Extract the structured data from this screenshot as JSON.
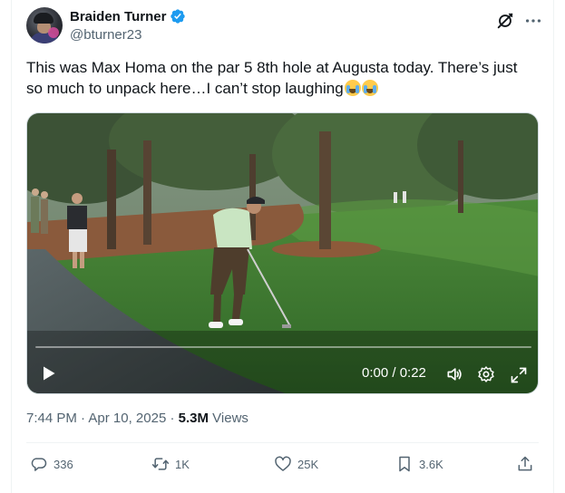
{
  "author": {
    "display_name": "Braiden Turner",
    "handle": "@bturner23",
    "verified": true
  },
  "icons": {
    "verified": "verified-badge-icon",
    "grok": "grok-icon",
    "more": "more-icon",
    "play": "play-icon",
    "volume": "volume-icon",
    "settings": "settings-icon",
    "fullscreen": "fullscreen-icon",
    "reply": "reply-icon",
    "repost": "repost-icon",
    "like": "like-icon",
    "bookmark": "bookmark-icon",
    "share": "share-icon"
  },
  "tweet": {
    "text": "This was Max Homa on the par 5 8th hole at Augusta today. There’s just so much to unpack here…I can’t stop laughing",
    "emoji": [
      "loudly-crying-face",
      "loudly-crying-face"
    ]
  },
  "video": {
    "time_display": "0:00 / 0:22",
    "progress": 0
  },
  "meta": {
    "time": "7:44 PM",
    "separator": "·",
    "date": "Apr 10, 2025",
    "views_count": "5.3M",
    "views_label": "Views"
  },
  "actions": {
    "replies": "336",
    "reposts": "1K",
    "likes": "25K",
    "bookmarks": "3.6K"
  },
  "colors": {
    "text_primary": "#0f1419",
    "text_secondary": "#536471",
    "verified_blue": "#1d9bf0",
    "divider": "#eff3f4"
  }
}
